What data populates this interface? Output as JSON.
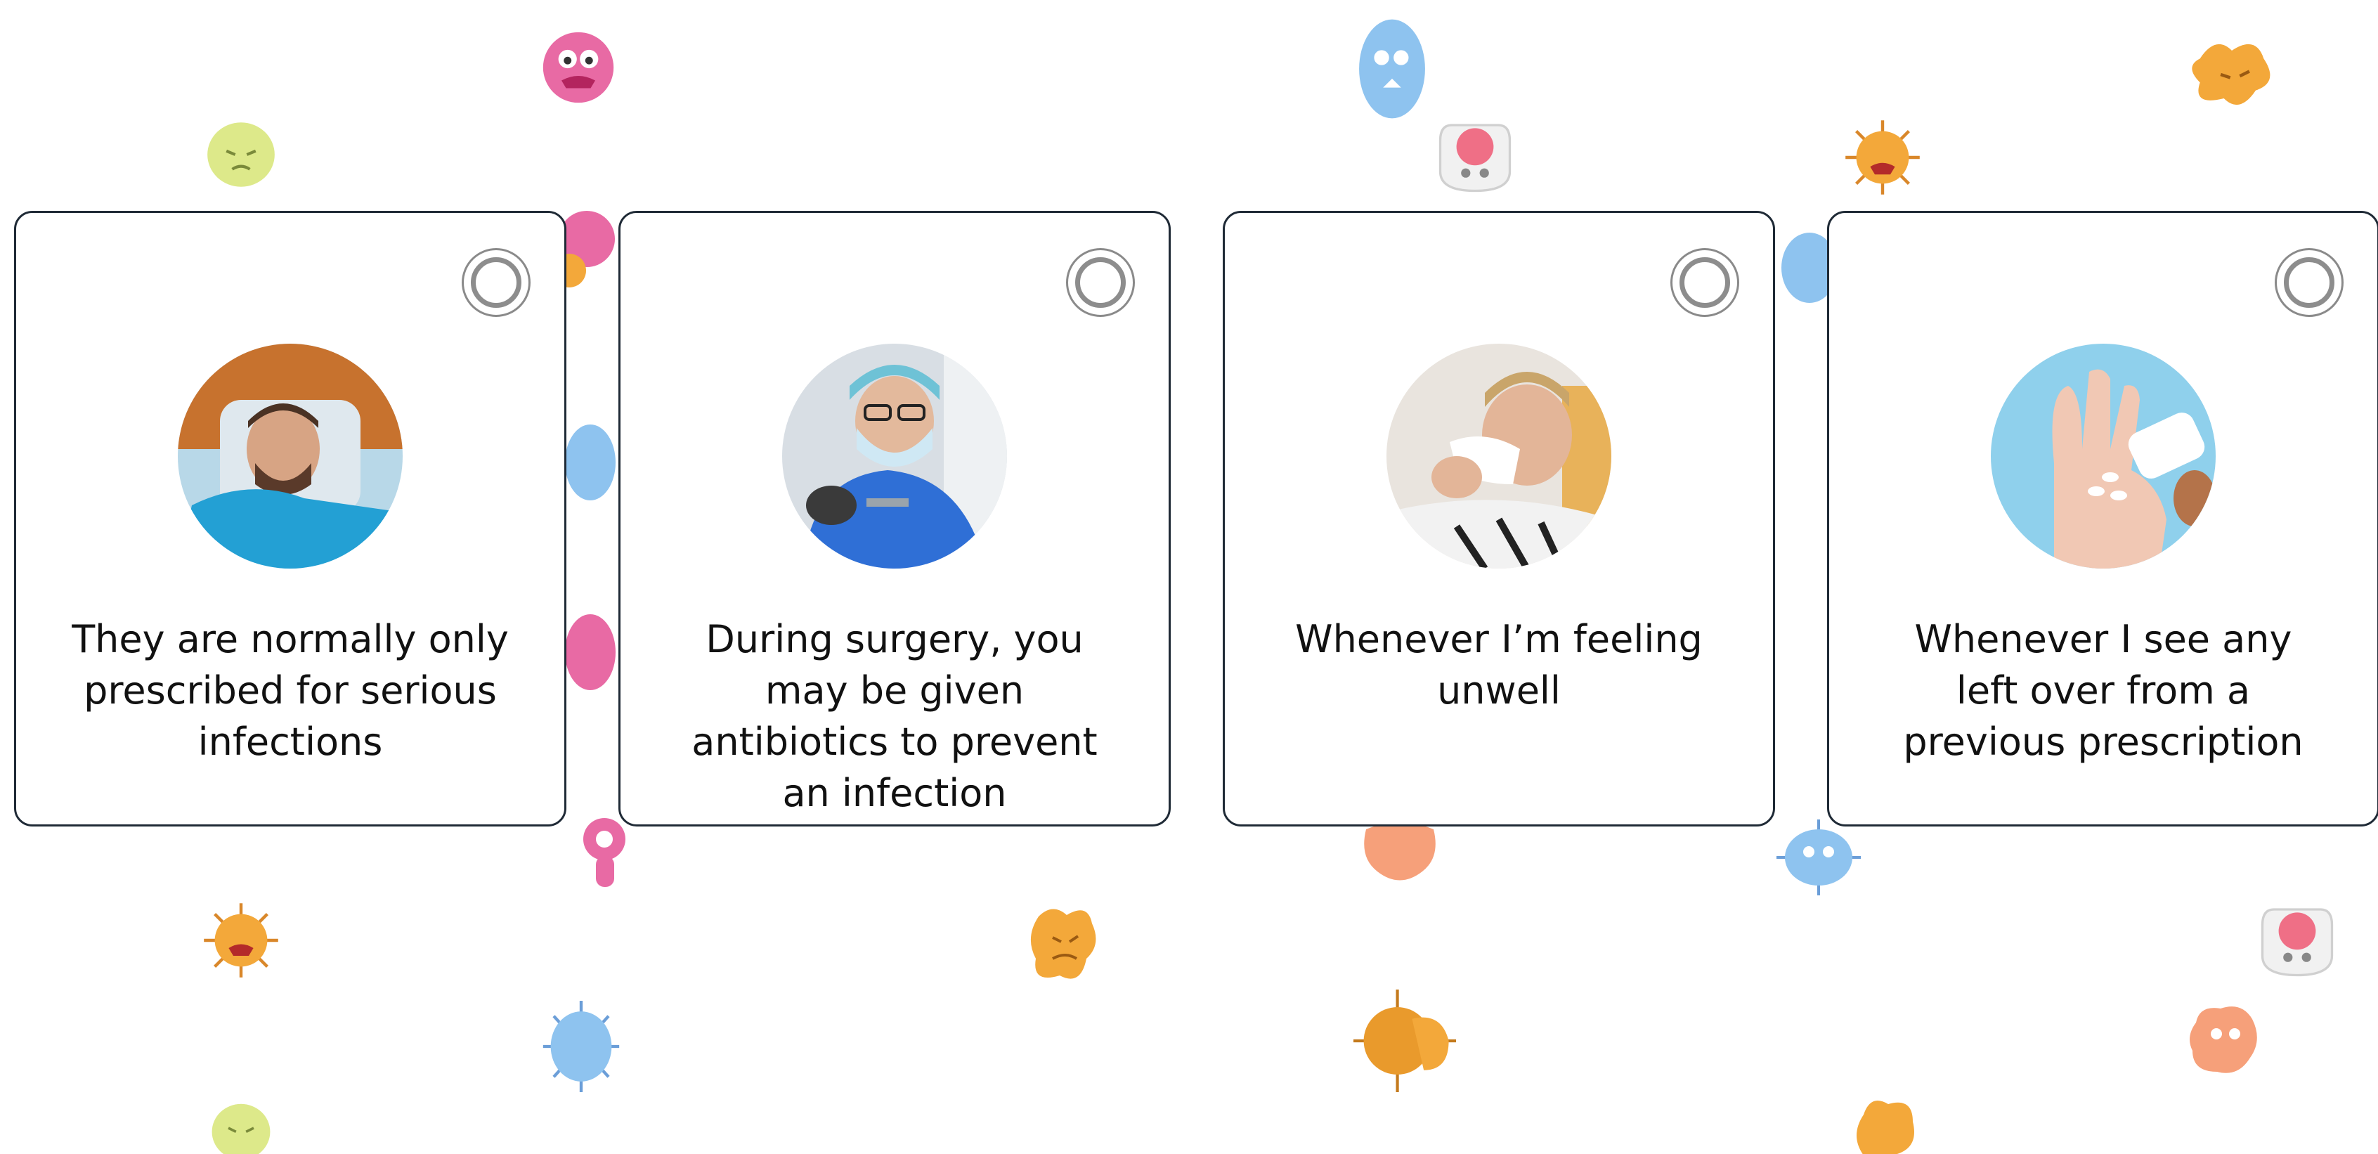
{
  "cards": [
    {
      "text": "They are normally only prescribed for serious infections",
      "image": "man-sleeping-hospital-bed"
    },
    {
      "text": "During surgery, you may be given antibiotics to prevent an infection",
      "image": "surgeon-operating"
    },
    {
      "text": "Whenever I’m feeling unwell",
      "image": "man-sick-blowing-nose"
    },
    {
      "text": "Whenever I see any left over from a previous prescription",
      "image": "pills-in-palm"
    }
  ],
  "colors": {
    "card_border": "#1f2a36",
    "radio_ring": "#8d8d8d",
    "text": "#111111",
    "germ_pink": "#e86aa4",
    "germ_blue": "#8ec3ef",
    "germ_orange": "#f3a83a",
    "germ_yellow": "#dde98a"
  }
}
